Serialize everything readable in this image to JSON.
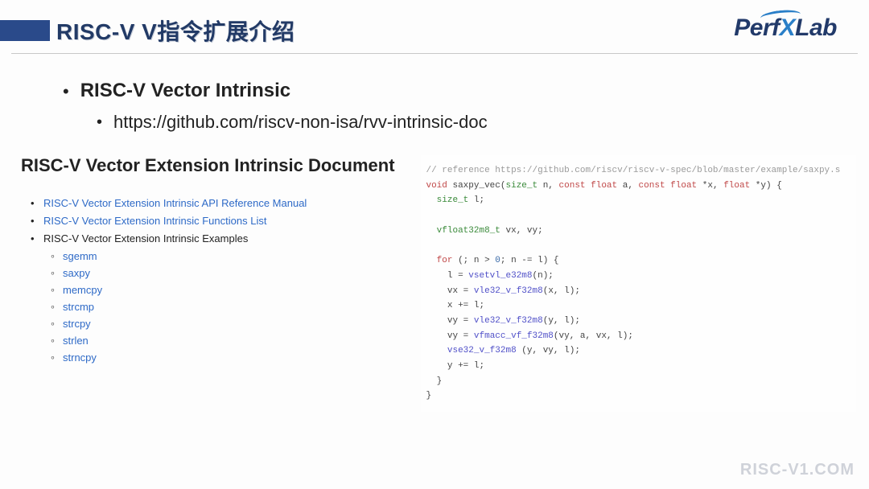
{
  "header": {
    "title": "RISC-V V指令扩展介绍",
    "logo_text_a": "Perf",
    "logo_text_x": "X",
    "logo_text_b": "Lab"
  },
  "bullets": {
    "main": "RISC-V Vector Intrinsic",
    "sub": "https://github.com/riscv-non-isa/rvv-intrinsic-doc"
  },
  "doc": {
    "title": "RISC-V Vector Extension Intrinsic Document",
    "items": [
      "RISC-V Vector Extension Intrinsic API Reference Manual",
      "RISC-V Vector Extension Intrinsic Functions List",
      "RISC-V Vector Extension Intrinsic Examples"
    ],
    "examples": [
      "sgemm",
      "saxpy",
      "memcpy",
      "strcmp",
      "strcpy",
      "strlen",
      "strncpy"
    ]
  },
  "code": {
    "comment": "// reference https://github.com/riscv/riscv-v-spec/blob/master/example/saxpy.s",
    "sig_void": "void",
    "sig_fn": " saxpy_vec(",
    "sig_size_t": "size_t",
    "sig_n": " n, ",
    "sig_cf1": "const float",
    "sig_a": " a, ",
    "sig_cf2": "const float",
    "sig_px": " *x, ",
    "sig_float": "float",
    "sig_py": " *y) {",
    "l_decl1a": "size_t",
    "l_decl1b": " l;",
    "l_decl2a": "vfloat32m8_t",
    "l_decl2b": " vx, vy;",
    "l_for": "for",
    "l_forcond": " (; n > ",
    "l_zero": "0",
    "l_forcond2": "; n -= l) {",
    "l_b1a": "    l = ",
    "l_b1fn": "vsetvl_e32m8",
    "l_b1b": "(n);",
    "l_b2a": "    vx = ",
    "l_b2fn": "vle32_v_f32m8",
    "l_b2b": "(x, l);",
    "l_b3": "    x += l;",
    "l_b4a": "    vy = ",
    "l_b4fn": "vle32_v_f32m8",
    "l_b4b": "(y, l);",
    "l_b5a": "    vy = ",
    "l_b5fn": "vfmacc_vf_f32m8",
    "l_b5b": "(vy, a, vx, l);",
    "l_b6a": "    ",
    "l_b6fn": "vse32_v_f32m8",
    "l_b6b": " (y, vy, l);",
    "l_b7": "    y += l;",
    "l_close1": "  }",
    "l_close2": "}"
  },
  "watermark": "RISC-V1.COM"
}
